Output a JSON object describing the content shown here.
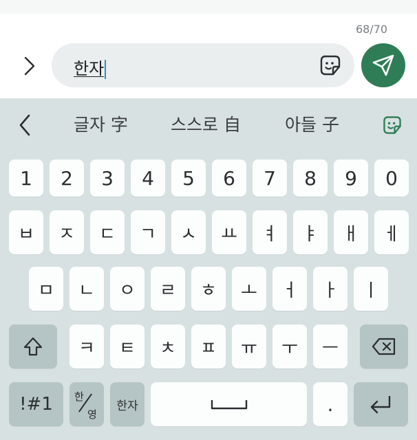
{
  "composer": {
    "char_counter": "68/70",
    "message_text": "한자",
    "expand_icon": "chevron-right-icon",
    "sticker_icon": "sticker-icon",
    "send_icon": "send-icon"
  },
  "keyboard": {
    "suggestions": [
      "글자 字",
      "스스로 自",
      "아들 子"
    ],
    "back_icon": "chevron-left-icon",
    "emoji_icon": "sticker-icon",
    "number_row": [
      "1",
      "2",
      "3",
      "4",
      "5",
      "6",
      "7",
      "8",
      "9",
      "0"
    ],
    "row1": [
      "ㅂ",
      "ㅈ",
      "ㄷ",
      "ㄱ",
      "ㅅ",
      "ㅛ",
      "ㅕ",
      "ㅑ",
      "ㅐ",
      "ㅔ"
    ],
    "row2": [
      "ㅁ",
      "ㄴ",
      "ㅇ",
      "ㄹ",
      "ㅎ",
      "ㅗ",
      "ㅓ",
      "ㅏ",
      "ㅣ"
    ],
    "row3": [
      "ㅋ",
      "ㅌ",
      "ㅊ",
      "ㅍ",
      "ㅠ",
      "ㅜ",
      "ㅡ"
    ],
    "shift_icon": "shift-arrow-icon",
    "backspace_icon": "backspace-icon",
    "symbols_label": "!#1",
    "lang_top": "한",
    "lang_bottom": "영",
    "hanja_label": "한자",
    "space_icon": "space-bar-icon",
    "period_label": ".",
    "enter_icon": "enter-return-icon",
    "accent_color": "#2e7d56",
    "keyboard_bg": "#d7e1e1"
  }
}
